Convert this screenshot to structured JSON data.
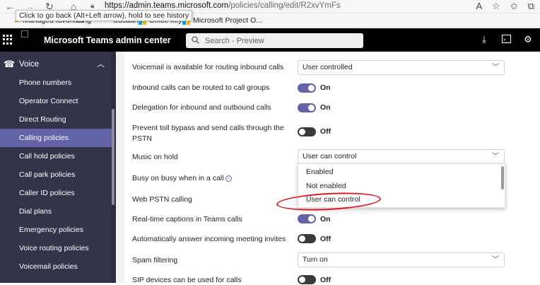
{
  "browser": {
    "url_host": "https://admin.teams.microsoft.com",
    "url_path": "/policies/calling/edit/R2xvYmFs",
    "tooltip": "Click to go back (Alt+Left arrow), hold to see history"
  },
  "bookmarks": [
    {
      "label": "Managed favorites"
    },
    {
      "label": "Bing"
    },
    {
      "label": "Susdaniel"
    },
    {
      "label": "Office key"
    },
    {
      "label": "Microsoft Project O..."
    }
  ],
  "header": {
    "title": "Microsoft Teams admin center",
    "search_placeholder": "Search - Preview"
  },
  "sidebar": {
    "section": "Voice",
    "items": [
      {
        "label": "Phone numbers"
      },
      {
        "label": "Operator Connect"
      },
      {
        "label": "Direct Routing"
      },
      {
        "label": "Calling policies"
      },
      {
        "label": "Call hold policies"
      },
      {
        "label": "Call park policies"
      },
      {
        "label": "Caller ID policies"
      },
      {
        "label": "Dial plans"
      },
      {
        "label": "Emergency policies"
      },
      {
        "label": "Voice routing policies"
      },
      {
        "label": "Voicemail policies"
      }
    ]
  },
  "settings": {
    "voicemail": {
      "label": "Voicemail is available for routing inbound calls",
      "value": "User controlled"
    },
    "inbound_groups": {
      "label": "Inbound calls can be routed to call groups",
      "state": "On"
    },
    "delegation": {
      "label": "Delegation for inbound and outbound calls",
      "state": "On"
    },
    "toll_bypass": {
      "label_1": "Prevent toll bypass and send calls through the",
      "label_2": "PSTN",
      "state": "Off"
    },
    "music_on_hold": {
      "label": "Music on hold",
      "value": "User can control"
    },
    "busy_on_busy": {
      "label": "Busy on busy when in a call"
    },
    "web_pstn": {
      "label": "Web PSTN calling"
    },
    "captions": {
      "label": "Real-time captions in Teams calls",
      "state": "On"
    },
    "auto_answer": {
      "label": "Automatically answer incoming meeting invites",
      "state": "Off"
    },
    "spam": {
      "label": "Spam filtering",
      "value": "Turn on"
    },
    "sip": {
      "label": "SIP devices can be used for calls",
      "state": "Off"
    }
  },
  "dropdown_options": [
    "Enabled",
    "Not enabled",
    "User can control"
  ],
  "colors": {
    "accent": "#6264a7",
    "sidebar": "#33344a",
    "annotation": "#e01b24"
  }
}
